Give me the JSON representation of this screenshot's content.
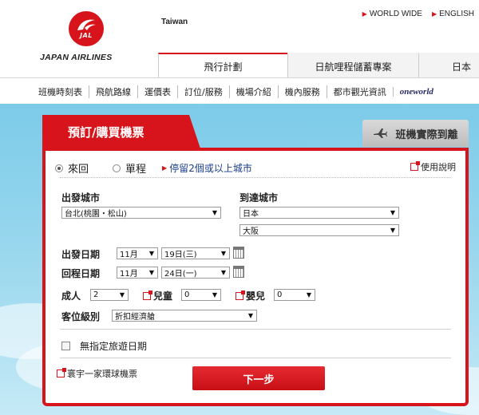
{
  "header": {
    "logo_mark": "JAL",
    "logo_text": "JAPAN AIRLINES",
    "region": "Taiwan",
    "top_links": [
      "WORLD WIDE",
      "ENGLISH"
    ],
    "main_tabs": [
      "飛行計劃",
      "日航哩程儲蓄專案",
      "日本"
    ]
  },
  "subnav": [
    "班機時刻表",
    "飛航路線",
    "運價表",
    "訂位/服務",
    "機場介紹",
    "機內服務",
    "都市觀光資訊",
    "oneworld"
  ],
  "booking": {
    "tab_active": "預訂/購買機票",
    "tab_secondary": "班機實際到離",
    "trip_types": [
      "來回",
      "單程"
    ],
    "selected_trip": "來回",
    "multi_city": "停留2個或以上城市",
    "help": "使用說明",
    "depart_city_label": "出發城市",
    "depart_city_value": "台北(桃園・松山)",
    "arrive_city_label": "到達城市",
    "arrive_country_value": "日本",
    "arrive_city_value": "大阪",
    "depart_date_label": "出發日期",
    "depart_month": "11月",
    "depart_day": "19日(三)",
    "return_date_label": "回程日期",
    "return_month": "11月",
    "return_day": "24日(一)",
    "adult_label": "成人",
    "adult_value": "2",
    "child_label": "兒童",
    "child_value": "0",
    "infant_label": "嬰兒",
    "infant_value": "0",
    "class_label": "客位級別",
    "class_value": "折扣經濟艙",
    "flexible_dates": "無指定旅遊日期",
    "world_ticket": "寰宇一家環球機票",
    "next_button": "下一步"
  },
  "colors": {
    "accent": "#d7131b",
    "link": "#1a3e8c"
  }
}
